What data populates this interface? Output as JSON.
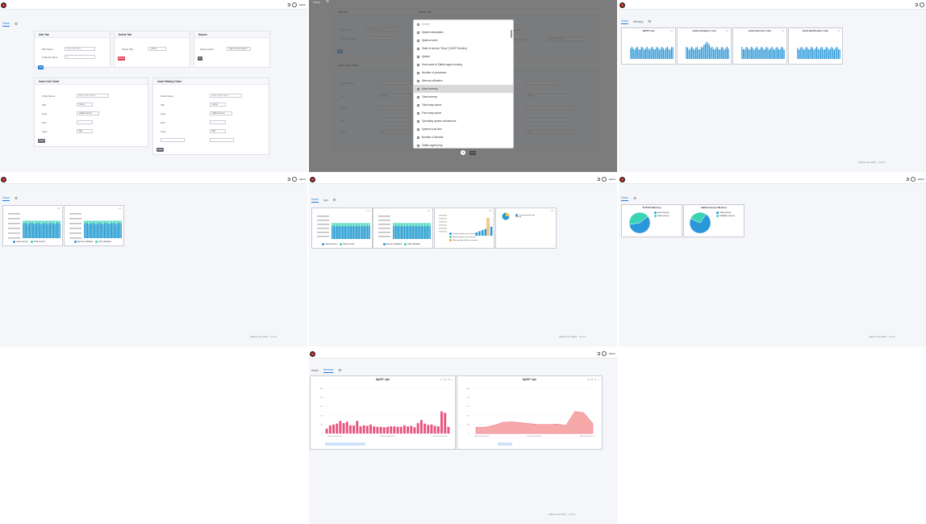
{
  "app": {
    "user": "zabbix",
    "footer_a": "Zabbix Gui 2024",
    "footer_b": "v1.0.0"
  },
  "tabs": {
    "home": "Home",
    "memory": "Memory",
    "cpu": "cpu"
  },
  "editor": {
    "add_tab": {
      "title": "Add Tab",
      "tab_name_label": "Tab Name",
      "tab_name_placeholder": "Enter tab name",
      "cells_label": "Cells Per Row",
      "cells_value": "1",
      "submit": "Add"
    },
    "delete_tab": {
      "title": "Delete Tab",
      "select_label": "Select Tab",
      "select_value": "Home",
      "submit": "Delete"
    },
    "source": {
      "title": "Source",
      "label": "Select Action",
      "value": "Save current layout",
      "submit": "Go"
    },
    "line_chart": {
      "title": "Insert Line Chart",
      "fields": [
        "Chart Name",
        "Tab",
        "Host",
        "Item",
        "Type"
      ],
      "name_placeholder": "Enter chart name",
      "tab_value": "Home",
      "host_value": "Zabbix server",
      "type_value": "Bar",
      "submit": "Insert"
    },
    "history_chart": {
      "title": "Insert History Chart",
      "fields": [
        "Chart Name",
        "Tab",
        "Host",
        "Item",
        "Type"
      ],
      "name_placeholder": "Enter chart name",
      "tab_value": "Home",
      "host_value": "Zabbix server",
      "type_value": "Bar",
      "submit": "Insert"
    }
  },
  "dropdown": {
    "search_placeholder": "Search",
    "items": [
      "System description",
      "System name",
      "State of service \"Dhcp\" (DHCP Monitor)",
      "Uptime",
      "Host name of Zabbix agent running",
      "Number of processes",
      "Memory utilization",
      "Used memory",
      "Total memory",
      "Total swap space",
      "Free swap space",
      "Operating system architecture",
      "System local time",
      "Number of threads",
      "Zabbix agent ping"
    ],
    "highlighted_index": 7,
    "confirm": "Insert"
  },
  "dashboards": {
    "p3_titles": [
      "tlp007 cpu",
      "www-manager-1 cpu",
      "www-telecom-1 cpu",
      "www-dashboard-1 cpu"
    ],
    "p4_legends": [
      [
        "Used memory",
        "Total memory"
      ],
      [
        "Memory utilization",
        "CPU utilization"
      ]
    ],
    "p5_legends": [
      [
        "Used memory",
        "Total memory"
      ],
      [
        "Memory utilization",
        "CPU utilization"
      ],
      [
        "Context switches per second",
        "Memory pages in per second",
        "Memory page faults per second"
      ],
      [
        "Context switches per second"
      ]
    ],
    "p6_cards": [
      {
        "title": "TLP007 Memory",
        "legend": [
          "Used memory",
          "Total memory"
        ]
      },
      {
        "title": "Zabbix Server Memory",
        "legend": [
          "Total memory",
          "Available memory"
        ]
      }
    ],
    "p8_cards": [
      {
        "title": "tlp007 cpu"
      },
      {
        "title": "tlp007 cpu"
      }
    ]
  },
  "chart_data": [
    {
      "type": "bar",
      "title": "tlp007 cpu",
      "ylim": [
        0,
        100
      ],
      "yticks": [
        "0",
        "20",
        "40",
        "60",
        "80",
        "100"
      ],
      "xticks": [
        "2024-11-20 09:45:17",
        "2024-11-20 09:46:17",
        "2024-11-20 09:47:17"
      ],
      "values": [
        11,
        18,
        20,
        22,
        28,
        23,
        26,
        18,
        18,
        28,
        16,
        18,
        17,
        20,
        16,
        15,
        15,
        14,
        15,
        16,
        16,
        15,
        15,
        18,
        16,
        17,
        14,
        23,
        30,
        22,
        19,
        20,
        17,
        16,
        49,
        46,
        15
      ],
      "color": "#e8557f"
    },
    {
      "type": "area",
      "title": "tlp007 cpu",
      "ylim": [
        0,
        100
      ],
      "yticks": [
        "0",
        "20",
        "40",
        "60",
        "80",
        "100"
      ],
      "xticks": [
        "2024-11-20 09:45:17",
        "2024-11-20 09:46:17",
        "2024-11-20 09:47:17"
      ],
      "values": [
        14,
        14,
        18,
        25,
        26,
        24,
        22,
        20,
        20,
        21,
        18,
        49,
        46,
        22
      ],
      "color": "#e8557f"
    },
    {
      "type": "pie",
      "title": "TLP007 Memory",
      "series": [
        {
          "name": "Used memory",
          "value": 58
        },
        {
          "name": "Total memory",
          "value": 42
        }
      ]
    },
    {
      "type": "pie",
      "title": "Zabbix Server Memory",
      "series": [
        {
          "name": "Total memory",
          "value": 72
        },
        {
          "name": "Available memory",
          "value": 28
        }
      ]
    }
  ],
  "colors": {
    "blue": "#2a97d8",
    "teal": "#3ad3b5",
    "pink": "#e8557f",
    "red": "#e04050",
    "navy": "#1e7ad8"
  }
}
